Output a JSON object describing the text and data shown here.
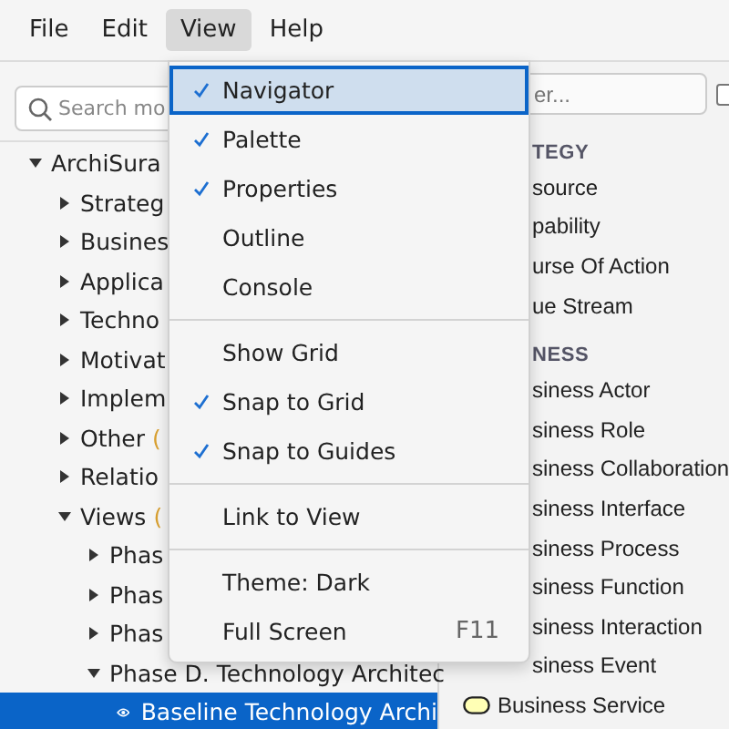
{
  "menubar": [
    {
      "label": "File",
      "selected": false
    },
    {
      "label": "Edit",
      "selected": false
    },
    {
      "label": "View",
      "selected": true
    },
    {
      "label": "Help",
      "selected": false
    }
  ],
  "search": {
    "placeholder": "Search mo"
  },
  "tree": [
    {
      "label": "ArchiSura",
      "expanded": true,
      "children": [
        {
          "label": "Strateg",
          "expanded": false
        },
        {
          "label": "Busines",
          "expanded": false
        },
        {
          "label": "Applica",
          "expanded": false
        },
        {
          "label": "Techno",
          "expanded": false
        },
        {
          "label": "Motivat",
          "expanded": false
        },
        {
          "label": "Implem",
          "expanded": false
        },
        {
          "label": "Other",
          "count": "(",
          "expanded": false
        },
        {
          "label": "Relatio",
          "expanded": false
        },
        {
          "label": "Views",
          "count": "(",
          "expanded": true,
          "children": [
            {
              "label": "Phas",
              "expanded": false
            },
            {
              "label": "Phas",
              "expanded": false
            },
            {
              "label": "Phas",
              "expanded": false
            },
            {
              "label": "Phase D. Technology Architec",
              "expanded": true,
              "children": [
                {
                  "label": "Baseline Technology Archi",
                  "kind": "view",
                  "selected": true
                }
              ]
            }
          ]
        }
      ]
    }
  ],
  "palette": {
    "filter": {
      "placeholder": "er..."
    },
    "checkbox": {
      "checked": false
    },
    "rows": [
      {
        "kind": "header",
        "label": "TEGY"
      },
      {
        "kind": "cut",
        "label": "source"
      },
      {
        "kind": "cut",
        "label": "pability"
      },
      {
        "kind": "cut",
        "label": "urse Of Action"
      },
      {
        "kind": "cut",
        "label": "ue Stream"
      },
      {
        "kind": "header",
        "label": "NESS"
      },
      {
        "kind": "cut",
        "label": "siness Actor"
      },
      {
        "kind": "cut",
        "label": "siness Role"
      },
      {
        "kind": "cut",
        "label": "siness Collaboration"
      },
      {
        "kind": "cut",
        "label": "siness Interface"
      },
      {
        "kind": "cut",
        "label": "siness Process"
      },
      {
        "kind": "cut",
        "label": "siness Function"
      },
      {
        "kind": "cut",
        "label": "siness Interaction"
      },
      {
        "kind": "cut",
        "label": "siness Event"
      },
      {
        "kind": "service",
        "label": "Business Service"
      }
    ]
  },
  "view_menu": [
    {
      "kind": "item",
      "label": "Navigator",
      "checked": true,
      "selected": true
    },
    {
      "kind": "item",
      "label": "Palette",
      "checked": true,
      "selected": false
    },
    {
      "kind": "item",
      "label": "Properties",
      "checked": true,
      "selected": false
    },
    {
      "kind": "item",
      "label": "Outline",
      "checked": false,
      "selected": false
    },
    {
      "kind": "item",
      "label": "Console",
      "checked": false,
      "selected": false
    },
    {
      "kind": "separator"
    },
    {
      "kind": "item",
      "label": "Show Grid",
      "checked": false,
      "selected": false
    },
    {
      "kind": "item",
      "label": "Snap to Grid",
      "checked": true,
      "selected": false
    },
    {
      "kind": "item",
      "label": "Snap to Guides",
      "checked": true,
      "selected": false
    },
    {
      "kind": "separator"
    },
    {
      "kind": "item",
      "label": "Link to View",
      "checked": false,
      "selected": false
    },
    {
      "kind": "separator"
    },
    {
      "kind": "item",
      "label": "Theme: Dark",
      "checked": false,
      "selected": false
    },
    {
      "kind": "item",
      "label": "Full Screen",
      "checked": false,
      "selected": false,
      "shortcut": "F11"
    }
  ]
}
